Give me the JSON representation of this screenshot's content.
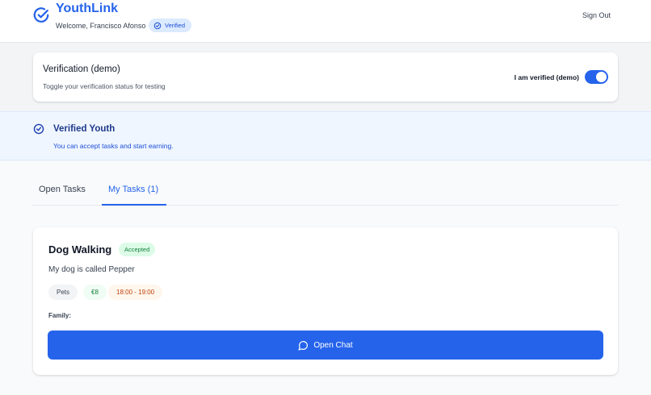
{
  "header": {
    "brand": "YouthLink",
    "welcome": "Welcome, Francisco Afonso",
    "verified_badge": "Verified",
    "sign_out": "Sign Out",
    "brand_icon": "circle-check-icon"
  },
  "verification": {
    "title": "Verification (demo)",
    "subtitle": "Toggle your verification status for testing",
    "toggle_label": "I am verified (demo)",
    "toggle_on": true
  },
  "banner": {
    "title": "Verified Youth",
    "subtitle": "You can accept tasks and start earning.",
    "icon": "circle-check-icon"
  },
  "tabs": [
    {
      "label": "Open Tasks",
      "active": false
    },
    {
      "label": "My Tasks (1)",
      "active": true
    }
  ],
  "task": {
    "title": "Dog Walking",
    "status": "Accepted",
    "description": "My dog is called Pepper",
    "category": "Pets",
    "price": "€8",
    "time": "18:00 - 19:00",
    "family_label": "Family:",
    "chat_button": "Open Chat",
    "chat_icon": "message-circle-icon"
  },
  "colors": {
    "primary": "#2563eb",
    "accepted_bg": "#dcfce7",
    "accepted_text": "#15803d",
    "time_text": "#c2410c",
    "banner_bg": "#eff6ff"
  }
}
